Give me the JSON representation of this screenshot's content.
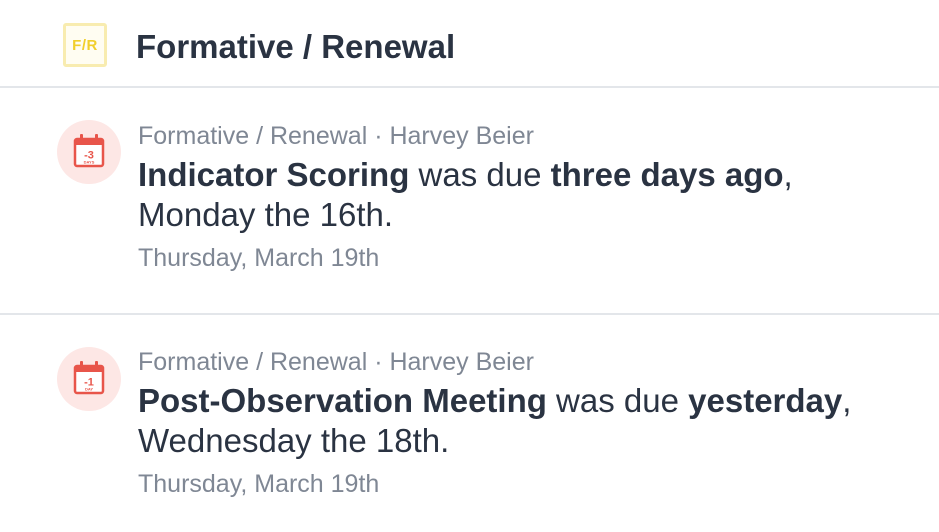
{
  "header": {
    "badge": "F/R",
    "title": "Formative / Renewal"
  },
  "colors": {
    "badge_text": "#f1cf2c",
    "badge_border": "#f8ecb0",
    "calendar_red": "#e8554a",
    "calendar_bg": "#fde7e5",
    "text_dark": "#2a3342",
    "text_muted": "#7f8794"
  },
  "notifications": [
    {
      "icon": "calendar-overdue-icon",
      "calendar_number": "-3",
      "calendar_unit": "DAYS",
      "meta": "Formative / Renewal · Harvey Beier",
      "task": "Indicator Scoring",
      "was_due": " was due ",
      "relative": "three days ago",
      "comma": ",",
      "weekday_date": "Monday the 16th.",
      "timestamp": "Thursday, March 19th"
    },
    {
      "icon": "calendar-overdue-icon",
      "calendar_number": "-1",
      "calendar_unit": "DAY",
      "meta": "Formative / Renewal · Harvey Beier",
      "task": "Post-Observation Meeting",
      "was_due": " was due ",
      "relative": "yesterday",
      "comma": ",",
      "weekday_date": "Wednesday the 18th.",
      "timestamp": "Thursday, March 19th"
    }
  ]
}
